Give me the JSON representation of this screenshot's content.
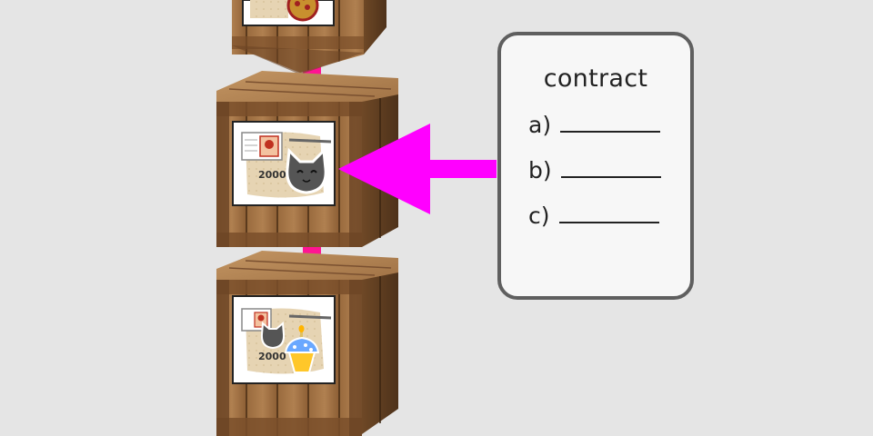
{
  "contract": {
    "title": "contract",
    "items": [
      {
        "label": "a)"
      },
      {
        "label": "b)"
      },
      {
        "label": "c)"
      }
    ]
  },
  "crates": [
    {
      "amount": ""
    },
    {
      "amount": "2000"
    },
    {
      "amount": "2000"
    }
  ],
  "colors": {
    "accent": "#ff00ff",
    "connector": "#ff1493",
    "wood_light": "#a4764a",
    "wood_dark": "#5a3a1d",
    "card_border": "#5f5f5f",
    "background": "#e5e5e5"
  },
  "icons": [
    "crate-icon",
    "contract-scroll-icon",
    "id-card-icon",
    "cat-face-icon",
    "cupcake-icon",
    "cookie-icon",
    "pen-icon"
  ]
}
